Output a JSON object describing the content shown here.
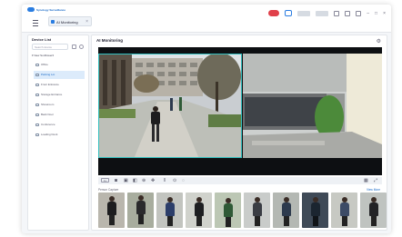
{
  "app": {
    "brand": "Synology Surveillance"
  },
  "tab": {
    "label": "AI Monitoring",
    "close": "×"
  },
  "window_controls": {
    "minimize": "–",
    "maximize": "□",
    "close": "×"
  },
  "sidebar": {
    "title": "Device List",
    "search_placeholder": "Search device",
    "root": "New Sunflower2",
    "items": [
      {
        "label": "Office",
        "active": false
      },
      {
        "label": "Parking Lot",
        "active": true
      },
      {
        "label": "Front Entrance",
        "active": false
      },
      {
        "label": "Storage Entrance",
        "active": false
      },
      {
        "label": "Showroom",
        "active": false
      },
      {
        "label": "Back Door",
        "active": false
      },
      {
        "label": "Conference",
        "active": false
      },
      {
        "label": "Loading Dock",
        "active": false
      }
    ]
  },
  "main": {
    "title": "AI Monitoring",
    "people_label": "Person Capture",
    "view_more": "View More",
    "speed": "1x"
  },
  "colors": {
    "accent": "#1769c7",
    "record": "#e0404a",
    "selection": "#33c0c0"
  },
  "icons": [
    "menu-icon",
    "search-icon",
    "refresh-icon",
    "gear-icon",
    "snapshot-icon",
    "record-icon",
    "zoom-icon",
    "play-icon",
    "layout-icon",
    "fullscreen-icon"
  ]
}
